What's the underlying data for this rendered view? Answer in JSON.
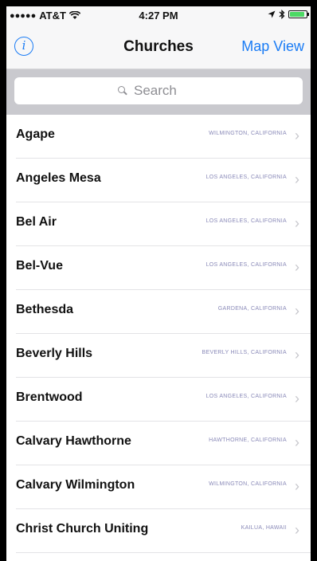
{
  "status_bar": {
    "carrier": "AT&T",
    "signal": "●●●●●",
    "time": "4:27 PM"
  },
  "nav": {
    "title": "Churches",
    "right_button": "Map View",
    "info_icon": "info-circle-icon"
  },
  "search": {
    "placeholder": "Search"
  },
  "churches": [
    {
      "name": "Agape",
      "location": "WILMINGTON, CALIFORNIA"
    },
    {
      "name": "Angeles Mesa",
      "location": "LOS ANGELES, CALIFORNIA"
    },
    {
      "name": "Bel Air",
      "location": "LOS ANGELES, CALIFORNIA"
    },
    {
      "name": "Bel-Vue",
      "location": "LOS ANGELES, CALIFORNIA"
    },
    {
      "name": "Bethesda",
      "location": "GARDENA, CALIFORNIA"
    },
    {
      "name": "Beverly Hills",
      "location": "BEVERLY HILLS, CALIFORNIA"
    },
    {
      "name": "Brentwood",
      "location": "LOS ANGELES, CALIFORNIA"
    },
    {
      "name": "Calvary Hawthorne",
      "location": "HAWTHORNE, CALIFORNIA"
    },
    {
      "name": "Calvary Wilmington",
      "location": "WILMINGTON, CALIFORNIA"
    },
    {
      "name": "Christ Church Uniting",
      "location": "KAILUA, HAWAII"
    }
  ],
  "colors": {
    "accent": "#1a7cf5",
    "location_text": "#8a8ab8",
    "chevron": "#c7c7cc"
  }
}
